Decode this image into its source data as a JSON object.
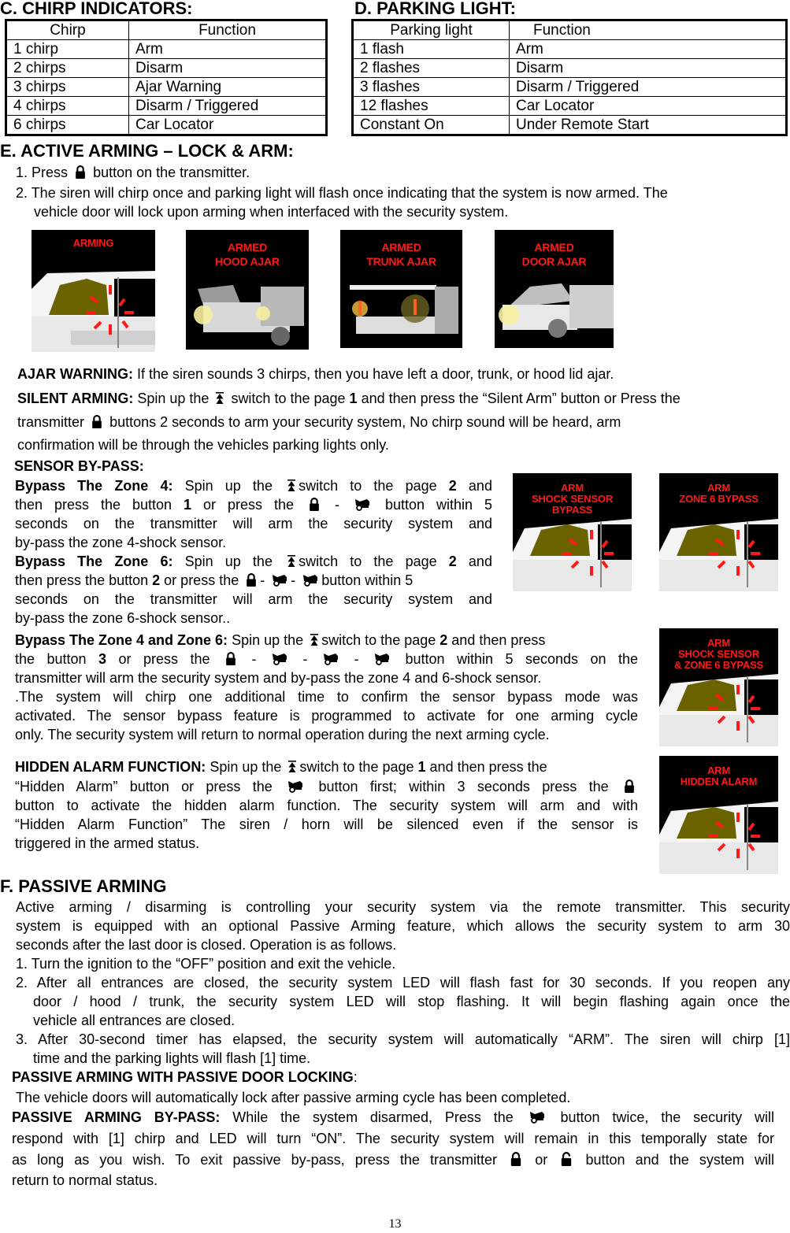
{
  "sections": {
    "chirp": {
      "title": "C. CHIRP INDICATORS:",
      "headers": [
        "Chirp",
        "Function"
      ],
      "rows": [
        [
          "1 chirp",
          "Arm"
        ],
        [
          "2 chirps",
          "Disarm"
        ],
        [
          "3 chirps",
          "Ajar Warning"
        ],
        [
          "4 chirps",
          "Disarm / Triggered"
        ],
        [
          "6 chirps",
          "Car Locator"
        ]
      ]
    },
    "parking": {
      "title": "D. PARKING LIGHT:",
      "headers": [
        "Parking light",
        "Function"
      ],
      "rows": [
        [
          "1 flash",
          "Arm"
        ],
        [
          "2 flashes",
          "Disarm"
        ],
        [
          "3 flashes",
          "Disarm / Triggered"
        ],
        [
          "12 flashes",
          "Car Locator"
        ],
        [
          "Constant On",
          "Under Remote Start"
        ]
      ]
    },
    "active": {
      "title": "E. ACTIVE ARMING – LOCK & ARM:",
      "step1_a": "1. Press",
      "step1_b": "button on the transmitter.",
      "step2_l1": "2. The siren will chirp once and parking light will flash once indicating that the system is now armed. The",
      "step2_l2": "vehicle door will lock upon arming when interfaced with the security system.",
      "images": [
        {
          "caption": "ARMING",
          "icon": "car-side-door-flash-image"
        },
        {
          "caption": "ARMED\nHOOD AJAR",
          "icon": "car-hood-open-image"
        },
        {
          "caption": "ARMED\nTRUNK AJAR",
          "icon": "car-trunk-open-image"
        },
        {
          "caption": "ARMED\nDOOR AJAR",
          "icon": "car-door-open-image"
        }
      ]
    },
    "ajar": {
      "label": "AJAR WARNING:",
      "text": " If the siren sounds 3 chirps, then you have left a door, trunk, or hood lid ajar."
    },
    "silent": {
      "label": "SILENT ARMING:",
      "l1_a": " Spin up the",
      "l1_b": "switch to the page",
      "l1_page": "1",
      "l1_c": "and then press the “Silent Arm” button or Press the",
      "l2_a": "transmitter",
      "l2_b": "buttons 2 seconds to arm your security system, No chirp sound will be heard, arm",
      "l3": "confirmation will be through the vehicles parking lights only."
    },
    "sensor": {
      "title": "SENSOR BY-PASS:",
      "zone4": {
        "label": "Bypass The Zone 4:",
        "l1_a": "Spin up the",
        "l1_b": "switch to the page",
        "page": "2",
        "l1_c": "and",
        "l2_a": "then press the button",
        "button": "1",
        "l2_b": "or press the",
        "l2_c": "button within 5",
        "l3": "seconds on the transmitter will arm the security system and",
        "l4": "by-pass the zone 4-shock sensor."
      },
      "zone6": {
        "label": "Bypass The Zone 6:",
        "l1_a": "Spin up the",
        "l1_b": "switch to the page",
        "page": "2",
        "l1_c": "and",
        "l2_a": "then press the button",
        "button": "2",
        "l2_b": "or press the",
        "l2_c": "button within 5",
        "l3": "seconds on the transmitter will arm the security system and",
        "l4": "by-pass the zone 6-shock sensor.."
      },
      "zone46": {
        "label": "Bypass The Zone 4 and Zone 6:",
        "l1_a": " Spin up the",
        "l1_b": "switch to the page",
        "page": "2",
        "l1_c": "and then press",
        "l2_a": "the button",
        "button": "3",
        "l2_b": "or press the",
        "l2_c": "button within 5 seconds on the",
        "l3": "transmitter will arm the security system and by-pass the zone 4 and 6-shock sensor.",
        "l4": ".The system will chirp one additional time to confirm the sensor bypass mode was",
        "l5": "activated. The sensor bypass feature is programmed to activate for one arming cycle",
        "l6": "only. The security system will return to normal operation during the next arming cycle."
      },
      "images": [
        {
          "caption": "ARM\nSHOCK SENSOR\nBYPASS"
        },
        {
          "caption": "ARM\nZONE 6 BYPASS"
        },
        {
          "caption": "ARM\nSHOCK SENSOR\n& ZONE 6 BYPASS"
        },
        {
          "caption": "ARM\nHIDDEN ALARM"
        }
      ]
    },
    "hidden": {
      "label": "HIDDEN ALARM FUNCTION:",
      "l1_a": " Spin up the",
      "l1_b": "switch to the page",
      "page": "1",
      "l1_c": "and then press the",
      "l2_a": "“Hidden Alarm” button or press the",
      "l2_b": "button first; within 3 seconds press the",
      "l3": "button to activate the hidden alarm function. The security system will arm and with",
      "l4": "“Hidden Alarm Function” The siren / horn will be silenced even if the sensor is",
      "l5": "triggered in the armed status."
    },
    "passive": {
      "title": "F. PASSIVE ARMING",
      "p1": "Active arming / disarming is controlling your security system via the remote transmitter. This security",
      "p2": "system is equipped with an optional Passive Arming feature, which allows the security system to arm 30",
      "p3": "seconds after the last door is closed. Operation is as follows.",
      "s1": "1. Turn the ignition to the “OFF” position and exit the vehicle.",
      "s2_l1": "2. After all entrances are closed, the security system LED will flash fast for 30 seconds. If you reopen any",
      "s2_l2": "door / hood / trunk, the security system LED will stop flashing. It will begin flashing again once the",
      "s2_l3": "vehicle all entrances are closed.",
      "s3_l1": "3. After 30-second timer has elapsed, the security system will automatically “ARM”. The siren will chirp [1]",
      "s3_l2": "time and the parking lights will flash [1] time.",
      "lock_label": "PASSIVE ARMING WITH PASSIVE DOOR LOCKING",
      "lock_colon": ":",
      "lock_text": "The vehicle doors will automatically lock after passive arming cycle has been completed.",
      "bypass_label": "PASSIVE ARMING BY-PASS:",
      "bp_l1_a": " While the system disarmed, Press the",
      "bp_l1_b": "button twice, the security will",
      "bp_l2": "respond with [1] chirp and LED will turn “ON”. The security system will remain in this temporally state for",
      "bp_l3_a": "as long as you wish. To exit passive by-pass, press the transmitter",
      "bp_l3_or": "or",
      "bp_l3_b": "button and the system will",
      "bp_l4": "return to normal status."
    }
  },
  "page_number": "13",
  "colors": {
    "caption_red": "#ff1a1a",
    "image_bg": "#000000"
  }
}
